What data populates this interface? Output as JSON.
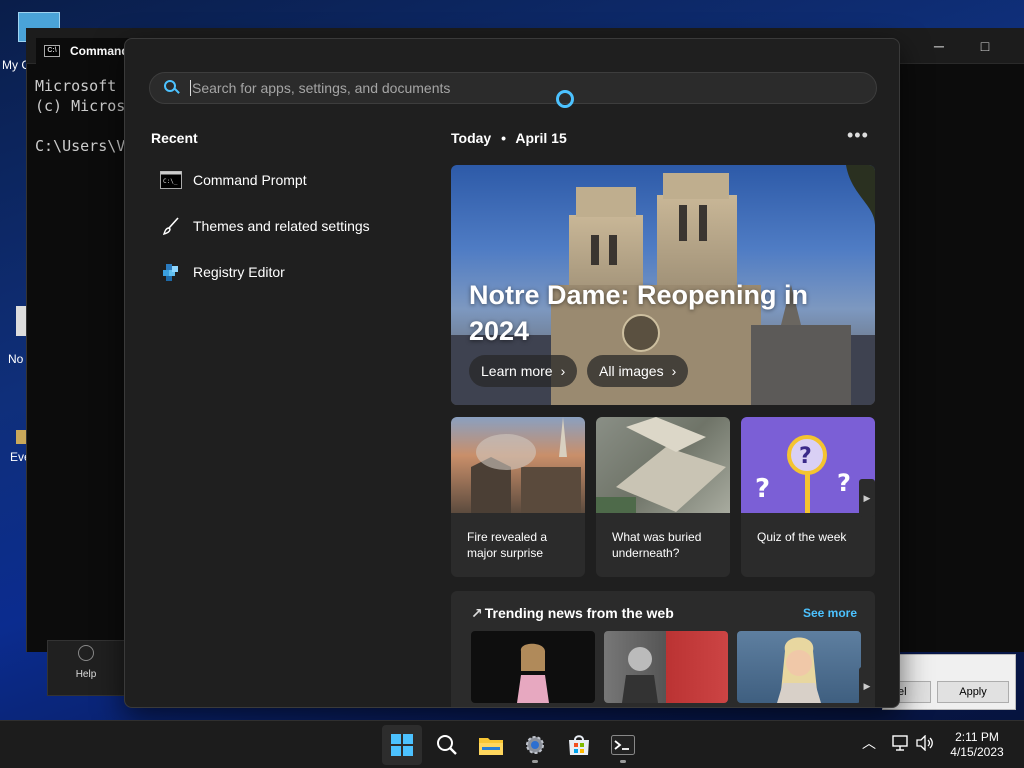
{
  "desktop": {
    "icons": [
      {
        "label": "My C"
      },
      {
        "label": "No"
      },
      {
        "label": "Eve"
      }
    ]
  },
  "cmd_window": {
    "tab_title": "Command",
    "lines": [
      "Microsoft ",
      "(c) Micros",
      "",
      "C:\\Users\\V"
    ]
  },
  "help_button": {
    "label": "Help"
  },
  "dialog": {
    "cancel_partial": "el",
    "apply_label": "Apply"
  },
  "start_menu": {
    "search": {
      "placeholder": "Search for apps, settings, and documents",
      "value": ""
    },
    "recent": {
      "title": "Recent",
      "items": [
        {
          "label": "Command Prompt",
          "icon": "command-prompt-icon"
        },
        {
          "label": "Themes and related settings",
          "icon": "paintbrush-icon"
        },
        {
          "label": "Registry Editor",
          "icon": "registry-editor-icon"
        }
      ]
    },
    "today": {
      "label": "Today",
      "separator": "•",
      "date": "April 15"
    },
    "hero": {
      "title": "Notre Dame: Reopening in 2024",
      "learn_more": "Learn more",
      "all_images": "All images"
    },
    "cards": [
      {
        "caption": "Fire revealed a major surprise"
      },
      {
        "caption": "What was buried underneath?"
      },
      {
        "caption": "Quiz of the week"
      }
    ],
    "trending": {
      "title": "Trending news from the web",
      "see_more": "See more"
    }
  },
  "taskbar": {
    "apps": [
      "start-icon",
      "search-icon",
      "file-explorer-icon",
      "settings-icon",
      "microsoft-store-icon",
      "terminal-icon"
    ],
    "clock": {
      "time": "2:11 PM",
      "date": "4/15/2023"
    }
  },
  "colors": {
    "accent": "#4cc2ff",
    "menu_bg": "#1f1f1f",
    "card_bg": "#2b2b2b"
  }
}
